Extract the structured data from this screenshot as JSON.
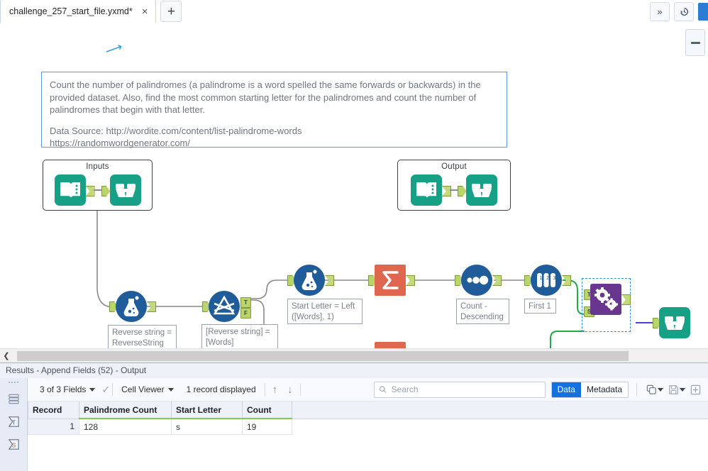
{
  "tab": {
    "title": "challenge_257_start_file.yxmd*",
    "close_label": "×",
    "new_tab_label": "+"
  },
  "topbar": {
    "overflow_label": "»",
    "history_label": "history-icon"
  },
  "canvas": {
    "zoom_out_label": "−",
    "comment": {
      "paragraph": "Count the number of palindromes (a palindrome is a word spelled the same forwards or backwards) in the provided dataset. Also, find the most common starting letter for the palindromes and count the number of palindromes that begin with that letter.",
      "source_line1": "Data Source:  http://wordite.com/content/list-palindrome-words",
      "source_line2": "https://randomwordgenerator.com/"
    },
    "containers": [
      {
        "title": "Inputs"
      },
      {
        "title": "Output"
      }
    ],
    "annotations": [
      {
        "id": "formula1",
        "text": "Reverse string = ReverseString ([Words])"
      },
      {
        "id": "filter1",
        "text": "[Reverse string] = [Words]"
      },
      {
        "id": "formula2",
        "text": "Start Letter = Left ([Words], 1)"
      },
      {
        "id": "sort1",
        "text": "Count - Descending"
      },
      {
        "id": "sample1",
        "text": "First 1"
      }
    ],
    "anchors": {
      "true_label": "T",
      "false_label": "F",
      "source_label": "S"
    }
  },
  "results": {
    "title": "Results - Append Fields (52) - Output",
    "toolbar": {
      "fields_label": "3 of 3 Fields",
      "viewer_label": "Cell Viewer",
      "records_label": "1 record displayed",
      "up_label": "↑",
      "down_label": "↓",
      "search_placeholder": "Search",
      "search_value": "",
      "data_label": "Data",
      "metadata_label": "Metadata"
    },
    "table": {
      "columns": [
        "Record",
        "Palindrome Count",
        "Start Letter",
        "Count"
      ],
      "rows": [
        {
          "record": "1",
          "palindrome_count": "128",
          "start_letter": "s",
          "count": "19"
        }
      ]
    }
  },
  "colors": {
    "accent_blue": "#1471dd",
    "tool_blue": "#1f5c99",
    "tool_teal": "#16a085",
    "tool_orange": "#e0674f",
    "tool_purple": "#68358f",
    "anchor_green": "#b9d468",
    "wire_green": "#22a94a",
    "wire_grey": "#8a8a8a",
    "selection_blue": "#2b8bd6"
  }
}
